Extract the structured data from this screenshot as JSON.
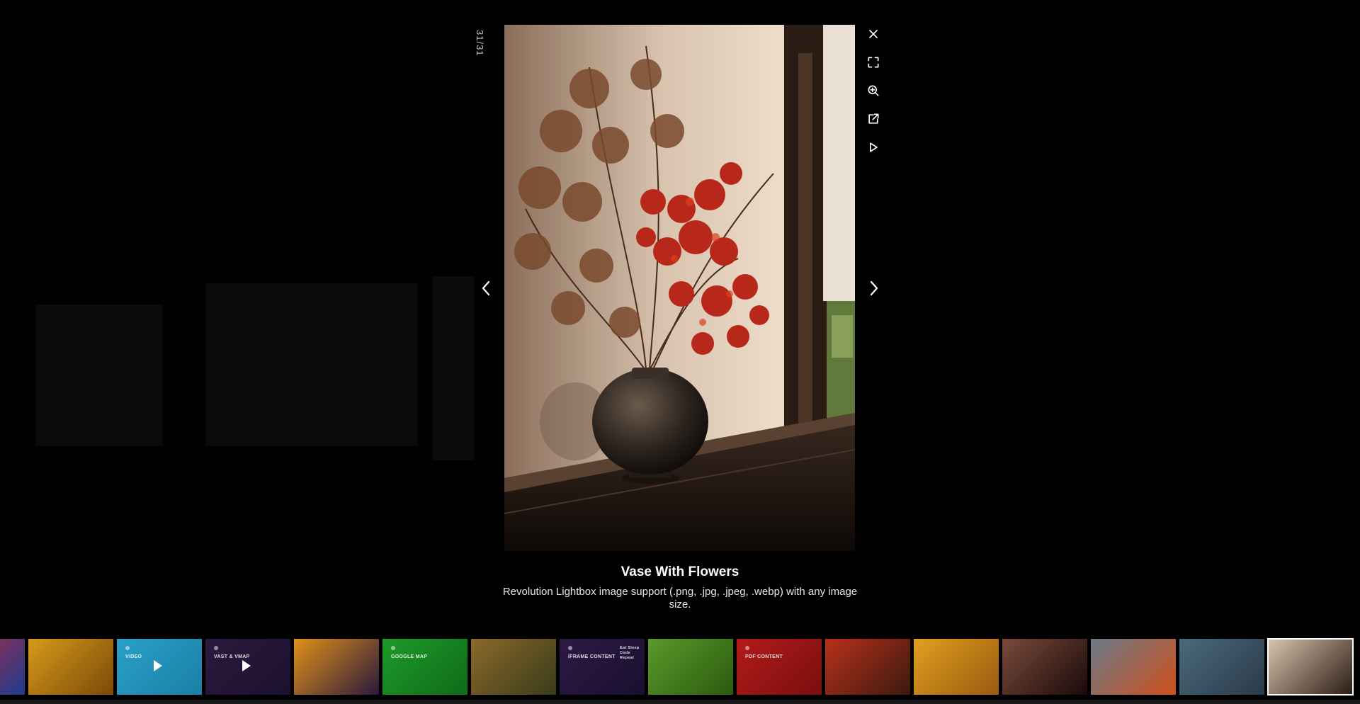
{
  "lightbox": {
    "counter": "31/31",
    "title": "Vase With Flowers",
    "description": "Revolution Lightbox image support (.png, .jpg, .jpeg, .webp) with any image size."
  },
  "toolbar": {
    "items": [
      {
        "name": "close",
        "icon": "close-icon"
      },
      {
        "name": "fullscreen",
        "icon": "fullscreen-icon"
      },
      {
        "name": "zoom",
        "icon": "zoom-in-icon"
      },
      {
        "name": "share",
        "icon": "share-icon"
      },
      {
        "name": "slideshow",
        "icon": "play-icon"
      }
    ]
  },
  "navigation": {
    "prev_icon": "chevron-left-icon",
    "next_icon": "chevron-right-icon"
  },
  "thumbnails": [
    {
      "kind": "image",
      "colors": [
        "#c22a3a",
        "#1b3c8f"
      ]
    },
    {
      "kind": "image",
      "colors": [
        "#d79a1a",
        "#7a4a08"
      ]
    },
    {
      "kind": "media",
      "label": "VIDEO",
      "colors": [
        "#2aa0c8",
        "#1a7fa6"
      ]
    },
    {
      "kind": "media",
      "label": "VAST & VMAP",
      "colors": [
        "#2b1a3d",
        "#1c1030"
      ]
    },
    {
      "kind": "image",
      "colors": [
        "#e0901a",
        "#2a1a3a"
      ]
    },
    {
      "kind": "media",
      "label": "GOOGLE MAP",
      "colors": [
        "#1e9a2a",
        "#0f6b18"
      ]
    },
    {
      "kind": "image",
      "colors": [
        "#8a6a2a",
        "#3a3a1a"
      ]
    },
    {
      "kind": "media",
      "label": "IFRAME CONTENT",
      "side_label": "Eat Sleep Code Repeat",
      "colors": [
        "#2d1a45",
        "#1a0f2e"
      ]
    },
    {
      "kind": "image",
      "colors": [
        "#5a9a2a",
        "#2a5a10"
      ]
    },
    {
      "kind": "media",
      "label": "PDF CONTENT",
      "colors": [
        "#b31a1a",
        "#7a0f0f"
      ]
    },
    {
      "kind": "image",
      "colors": [
        "#b8301a",
        "#3a1a10"
      ]
    },
    {
      "kind": "image",
      "colors": [
        "#e0a020",
        "#9a5a10"
      ]
    },
    {
      "kind": "image",
      "colors": [
        "#7a4a3a",
        "#1a0a0a"
      ]
    },
    {
      "kind": "image",
      "colors": [
        "#6a7a8a",
        "#d0501a"
      ]
    },
    {
      "kind": "image",
      "colors": [
        "#4a6a7a",
        "#2a3a4a"
      ]
    },
    {
      "kind": "image",
      "active": true,
      "colors": [
        "#d9c6b0",
        "#2a1a12"
      ]
    }
  ],
  "colors": {
    "background": "#000000",
    "active_border": "#ffffff"
  }
}
